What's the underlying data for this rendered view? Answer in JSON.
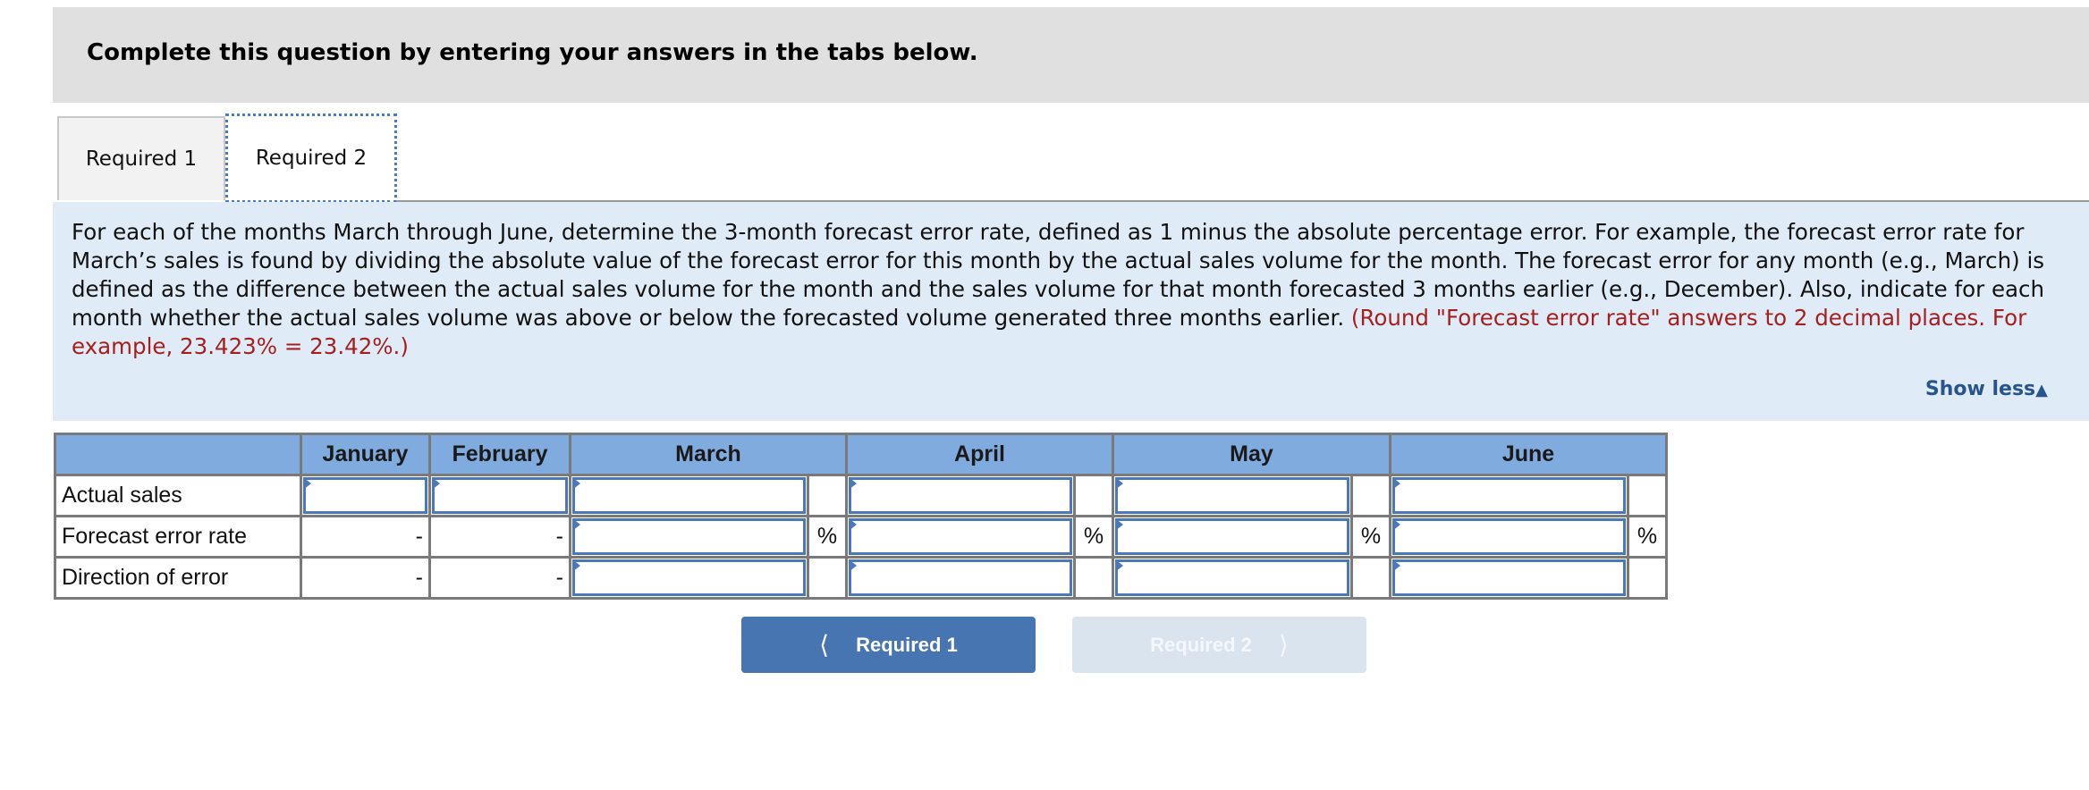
{
  "header": {
    "instruction": "Complete this question by entering your answers in the tabs below."
  },
  "tabs": [
    {
      "label": "Required 1",
      "active": false
    },
    {
      "label": "Required 2",
      "active": true
    }
  ],
  "panel": {
    "text": "For each of the months March through June, determine the 3-month forecast error rate, defined as 1 minus the absolute percentage error. For example, the forecast error rate for March’s sales is found by dividing the absolute value of the forecast error for this month by the actual sales volume for the month. The forecast error for any month (e.g., March) is defined as the difference between the actual sales volume for the month and the sales volume for that month forecasted 3 months earlier (e.g., December). Also, indicate for each month whether the actual sales volume was above or below the forecasted volume generated three months earlier.",
    "note": "(Round \"Forecast error rate\" answers to 2 decimal places. For example, 23.423% = 23.42%.)",
    "show_less_label": "Show less",
    "show_less_icon": "triangle-up-icon"
  },
  "table": {
    "columns": [
      "",
      "January",
      "February",
      "March",
      "April",
      "May",
      "June"
    ],
    "rows": [
      {
        "label": "Actual sales",
        "january": "",
        "february": "",
        "march": "",
        "april": "",
        "may": "",
        "june": "",
        "unit": ""
      },
      {
        "label": "Forecast error rate",
        "january": "-",
        "february": "-",
        "march": "",
        "april": "",
        "may": "",
        "june": "",
        "unit": "%"
      },
      {
        "label": "Direction of error",
        "january": "-",
        "february": "-",
        "march": "",
        "april": "",
        "may": "",
        "june": "",
        "unit": ""
      }
    ]
  },
  "nav": {
    "prev_label": "Required 1",
    "next_label": "Required 2",
    "prev_icon": "chevron-left-icon",
    "next_icon": "chevron-right-icon",
    "next_disabled": true
  },
  "colors": {
    "header_bg": "#e0e0e0",
    "panel_bg": "#dfecf8",
    "table_header_bg": "#80abdf",
    "input_border": "#4a78b8",
    "note_red": "#a51f1f",
    "link_blue": "#28548e",
    "prev_btn": "#4675b2",
    "next_btn_disabled": "#dae4ef"
  }
}
